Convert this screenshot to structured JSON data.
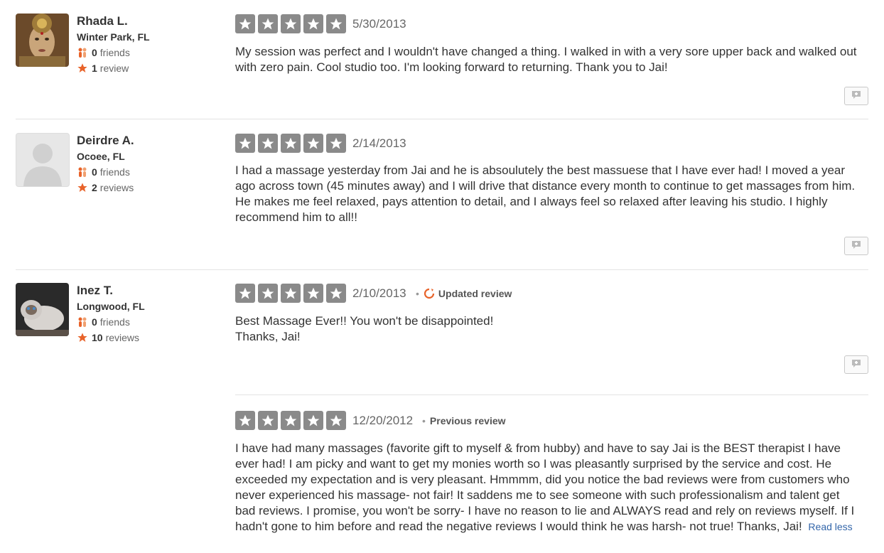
{
  "reviews": [
    {
      "name": "Rhada L.",
      "location": "Winter Park, FL",
      "friends_count": "0",
      "friends_label": "friends",
      "reviews_count": "1",
      "reviews_label": "review",
      "rating": 5,
      "date": "5/30/2013",
      "text": "My session was perfect and I wouldn't have changed a thing. I walked in with a very sore upper back and walked out with zero pain. Cool studio too. I'm looking forward to returning. Thank you to Jai!"
    },
    {
      "name": "Deirdre A.",
      "location": "Ocoee, FL",
      "friends_count": "0",
      "friends_label": "friends",
      "reviews_count": "2",
      "reviews_label": "reviews",
      "rating": 5,
      "date": "2/14/2013",
      "text": "I had a massage yesterday from Jai and he is absoulutely the best massuese that I have ever had!  I moved a year ago across town (45 minutes away) and I will drive that distance every month to continue to get massages from him.  He makes me feel relaxed, pays attention to detail, and I always feel so relaxed after leaving his studio. I highly recommend him to all!!"
    },
    {
      "name": "Inez T.",
      "location": "Longwood, FL",
      "friends_count": "0",
      "friends_label": "friends",
      "reviews_count": "10",
      "reviews_label": "reviews",
      "rating": 5,
      "date": "2/10/2013",
      "tag": "Updated review",
      "text": "Best Massage Ever!!   You won't be disappointed!\nThanks, Jai!",
      "previous": {
        "rating": 5,
        "date": "12/20/2012",
        "tag": "Previous review",
        "text": "I have had many massages (favorite gift to myself & from hubby) and have to say Jai is the BEST therapist I have ever had! I am picky and want to get my monies worth so I was pleasantly surprised by the service and cost. He exceeded my expectation and is very pleasant. Hmmmm, did you notice the bad reviews were from customers who never experienced his massage- not fair! It saddens me to see someone with such professionalism and talent get bad reviews. I promise, you won't be sorry- I have no reason to lie and ALWAYS read and rely on reviews myself. If I hadn't gone to him before and read the negative reviews I would think he was harsh- not true! Thanks, Jai!",
        "read_less": "Read less"
      }
    }
  ],
  "colors": {
    "star_bg": "#8a8a8a",
    "accent_orange": "#e8632a",
    "link_blue": "#3366aa"
  },
  "icons": {
    "friends": "friends-icon",
    "reviews": "star-icon",
    "updated": "refresh-icon",
    "comment": "comment-icon"
  }
}
